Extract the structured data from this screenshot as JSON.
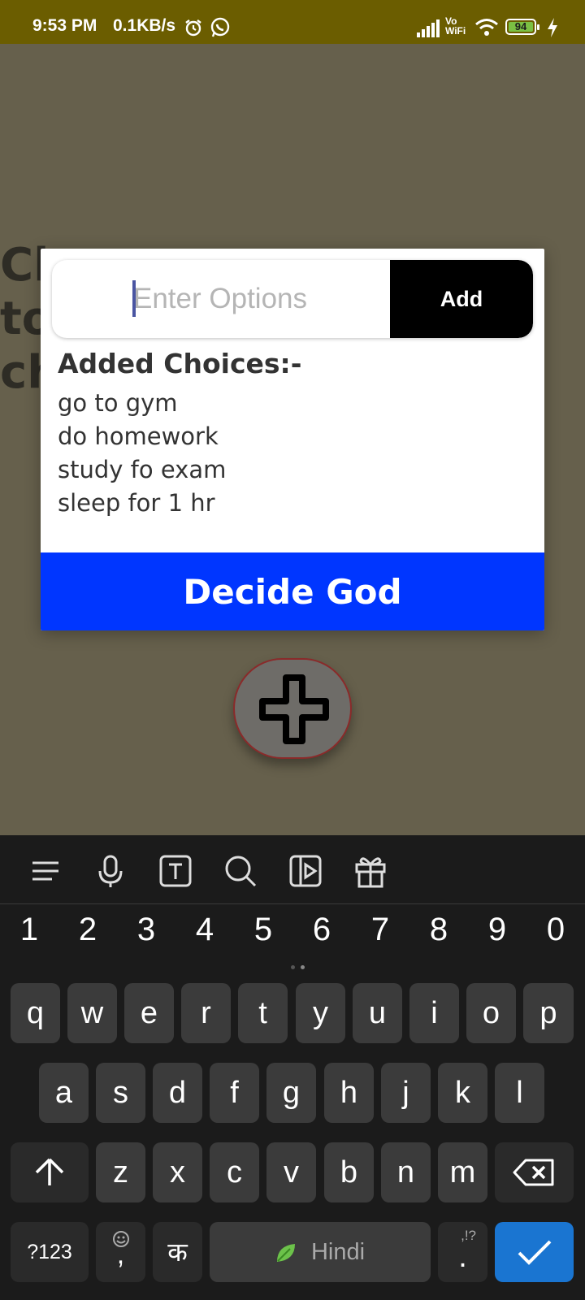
{
  "status_bar": {
    "time": "9:53 PM",
    "net_speed": "0.1KB/s",
    "vowifi": "Vo\nWiFi",
    "battery": "94"
  },
  "background": {
    "heading_fragments": "Cl\nto\nch"
  },
  "dialog": {
    "input_placeholder": "Enter Options",
    "add_label": "Add",
    "choices_title": "Added Choices:-",
    "choices": [
      "go to gym",
      "do homework",
      "study fo exam",
      "sleep for 1 hr"
    ],
    "decide_label": "Decide God"
  },
  "keyboard": {
    "numbers": [
      "1",
      "2",
      "3",
      "4",
      "5",
      "6",
      "7",
      "8",
      "9",
      "0"
    ],
    "row1": [
      "q",
      "w",
      "e",
      "r",
      "t",
      "y",
      "u",
      "i",
      "o",
      "p"
    ],
    "row2": [
      "a",
      "s",
      "d",
      "f",
      "g",
      "h",
      "j",
      "k",
      "l"
    ],
    "row3": [
      "z",
      "x",
      "c",
      "v",
      "b",
      "n",
      "m"
    ],
    "sym_label": "?123",
    "lang_key": "क",
    "comma": ",",
    "space_label": "Hindi",
    "period": ".",
    "period_alt": ",!?"
  },
  "colors": {
    "status_bar": "#6b5d00",
    "accent_button": "#0036ff",
    "add_button": "#000000",
    "done_key": "#1a75d1"
  }
}
